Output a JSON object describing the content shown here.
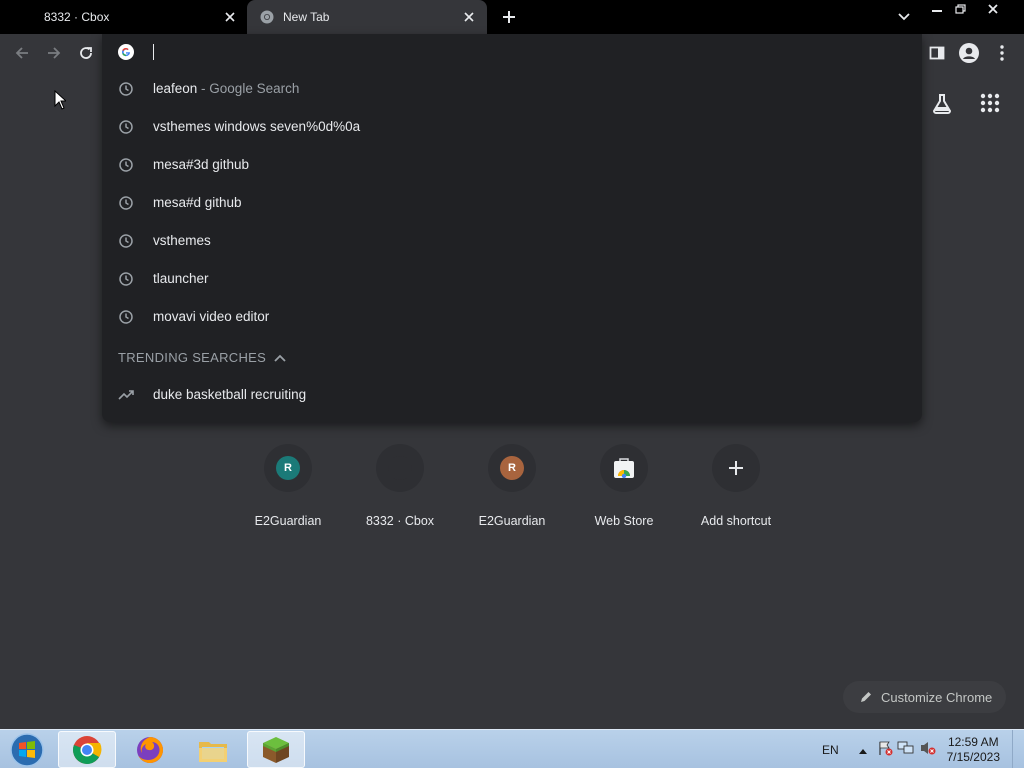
{
  "tabs": [
    {
      "title": "8332 · Cbox"
    },
    {
      "title": "New Tab"
    }
  ],
  "omnibox": {
    "value": "",
    "suggestions": [
      {
        "text": "leafeon",
        "sub": " - Google Search"
      },
      {
        "text": "vsthemes windows seven%0d%0a",
        "sub": ""
      },
      {
        "text": "mesa#3d github",
        "sub": ""
      },
      {
        "text": "mesa#d github",
        "sub": ""
      },
      {
        "text": "vsthemes",
        "sub": ""
      },
      {
        "text": "tlauncher",
        "sub": ""
      },
      {
        "text": "movavi video editor",
        "sub": ""
      }
    ],
    "trending_header": "TRENDING SEARCHES",
    "trending": [
      {
        "text": "duke basketball recruiting"
      }
    ]
  },
  "shortcuts": [
    {
      "label": "E2Guardian",
      "initial": "R",
      "color": "#1b7a78"
    },
    {
      "label": "8332 · Cbox",
      "initial": "",
      "color": "#2e2f33"
    },
    {
      "label": "E2Guardian",
      "initial": "R",
      "color": "#a8643e"
    },
    {
      "label": "Web Store",
      "initial": "",
      "color": "#ffffff"
    },
    {
      "label": "Add shortcut",
      "initial": "+",
      "color": "transparent"
    }
  ],
  "customize_label": "Customize Chrome",
  "taskbar": {
    "language": "EN",
    "time": "12:59 AM",
    "date": "7/15/2023"
  },
  "colors": {
    "tab_active": "#35363a",
    "page_bg": "#35363a",
    "omnibox_bg": "#202124",
    "text": "#e8eaed",
    "muted": "#9aa0a6"
  }
}
